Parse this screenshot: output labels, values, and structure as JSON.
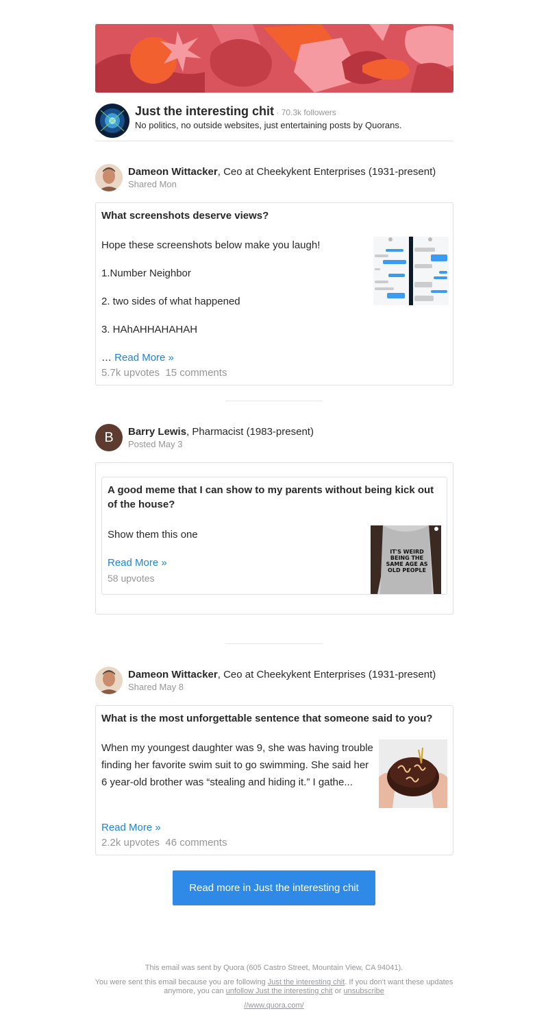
{
  "space": {
    "title": "Just the interesting chit",
    "followers": " · 70.3k followers",
    "description": "No politics, no outside websites, just entertaining posts by Quorans."
  },
  "posts": [
    {
      "author_name": "Dameon Wittacker",
      "author_cred": ", Ceo at Cheekykent Enterprises (1931-present)",
      "meta": "Shared Mon",
      "question": "What screenshots deserve views?",
      "lines": [
        "Hope these screenshots below make you laugh!",
        "1.Number Neighbor",
        "2. two sides of what happened",
        "3. HAhAHHAHAHAH"
      ],
      "ellipsis": "… ",
      "read_more": "Read More »",
      "upvotes": "5.7k upvotes",
      "comments": "15 comments"
    },
    {
      "author_initial": "B",
      "author_name": "Barry Lewis",
      "author_cred": ", Pharmacist (1983-present)",
      "meta": "Posted May 3",
      "question": "A good meme that I can show to my parents without being kick out of the house?",
      "text": "Show them this one",
      "read_more": "Read More »",
      "upvotes": "58 upvotes",
      "image_text": "IT'S WEIRD BEING THE SAME AGE AS OLD PEOPLE"
    },
    {
      "author_name": "Dameon Wittacker",
      "author_cred": ", Ceo at Cheekykent Enterprises (1931-present)",
      "meta": "Shared May 8",
      "question": "What is the most unforgettable sentence that someone said to you?",
      "text": "When my youngest daughter was 9, she was having trouble finding her favorite swim suit to go swimming. She said her 6 year-old brother was “stealing and hiding it.” I gathe...",
      "read_more": "Read More »",
      "upvotes": "2.2k upvotes",
      "comments": "46 comments"
    }
  ],
  "cta": "Read more in Just the interesting chit",
  "footer": {
    "sent_by": "This email was sent by Quora (605 Castro Street, Mountain View, CA 94041).",
    "reason_pre": "You were sent this email because you are following ",
    "reason_link": "Just the interesting chit",
    "reason_mid": ". If you don't want these updates anymore, you can ",
    "unfollow": "unfollow Just the interesting chit",
    "or": " or ",
    "unsubscribe": "unsubscribe",
    "url": "//www.quora.com/"
  },
  "colors": {
    "accent": "#2e8ae6",
    "link": "#1a85d6",
    "muted": "#939598"
  }
}
